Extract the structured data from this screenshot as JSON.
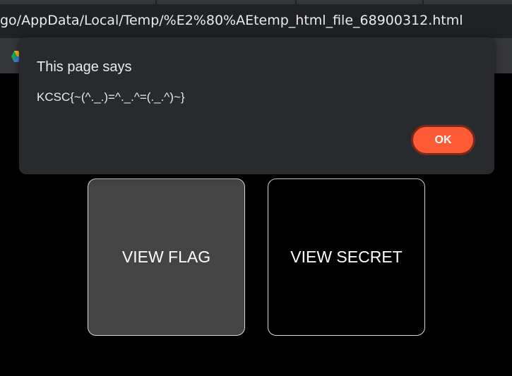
{
  "browser": {
    "url": "go/AppData/Local/Temp/%E2%80%AEtemp_html_file_68900312.html",
    "bookmark_icon": "google-drive-icon"
  },
  "page": {
    "cards": [
      {
        "label": "VIEW FLAG"
      },
      {
        "label": "VIEW SECRET"
      }
    ]
  },
  "dialog": {
    "title": "This page says",
    "message": "KCSC{~(^._.)=^._.^=(._.^)~}",
    "ok_label": "OK"
  },
  "colors": {
    "accent": "#ff5a36",
    "dialog_bg": "#292a2d",
    "page_bg": "#000000",
    "flag_card_bg": "#444444"
  }
}
